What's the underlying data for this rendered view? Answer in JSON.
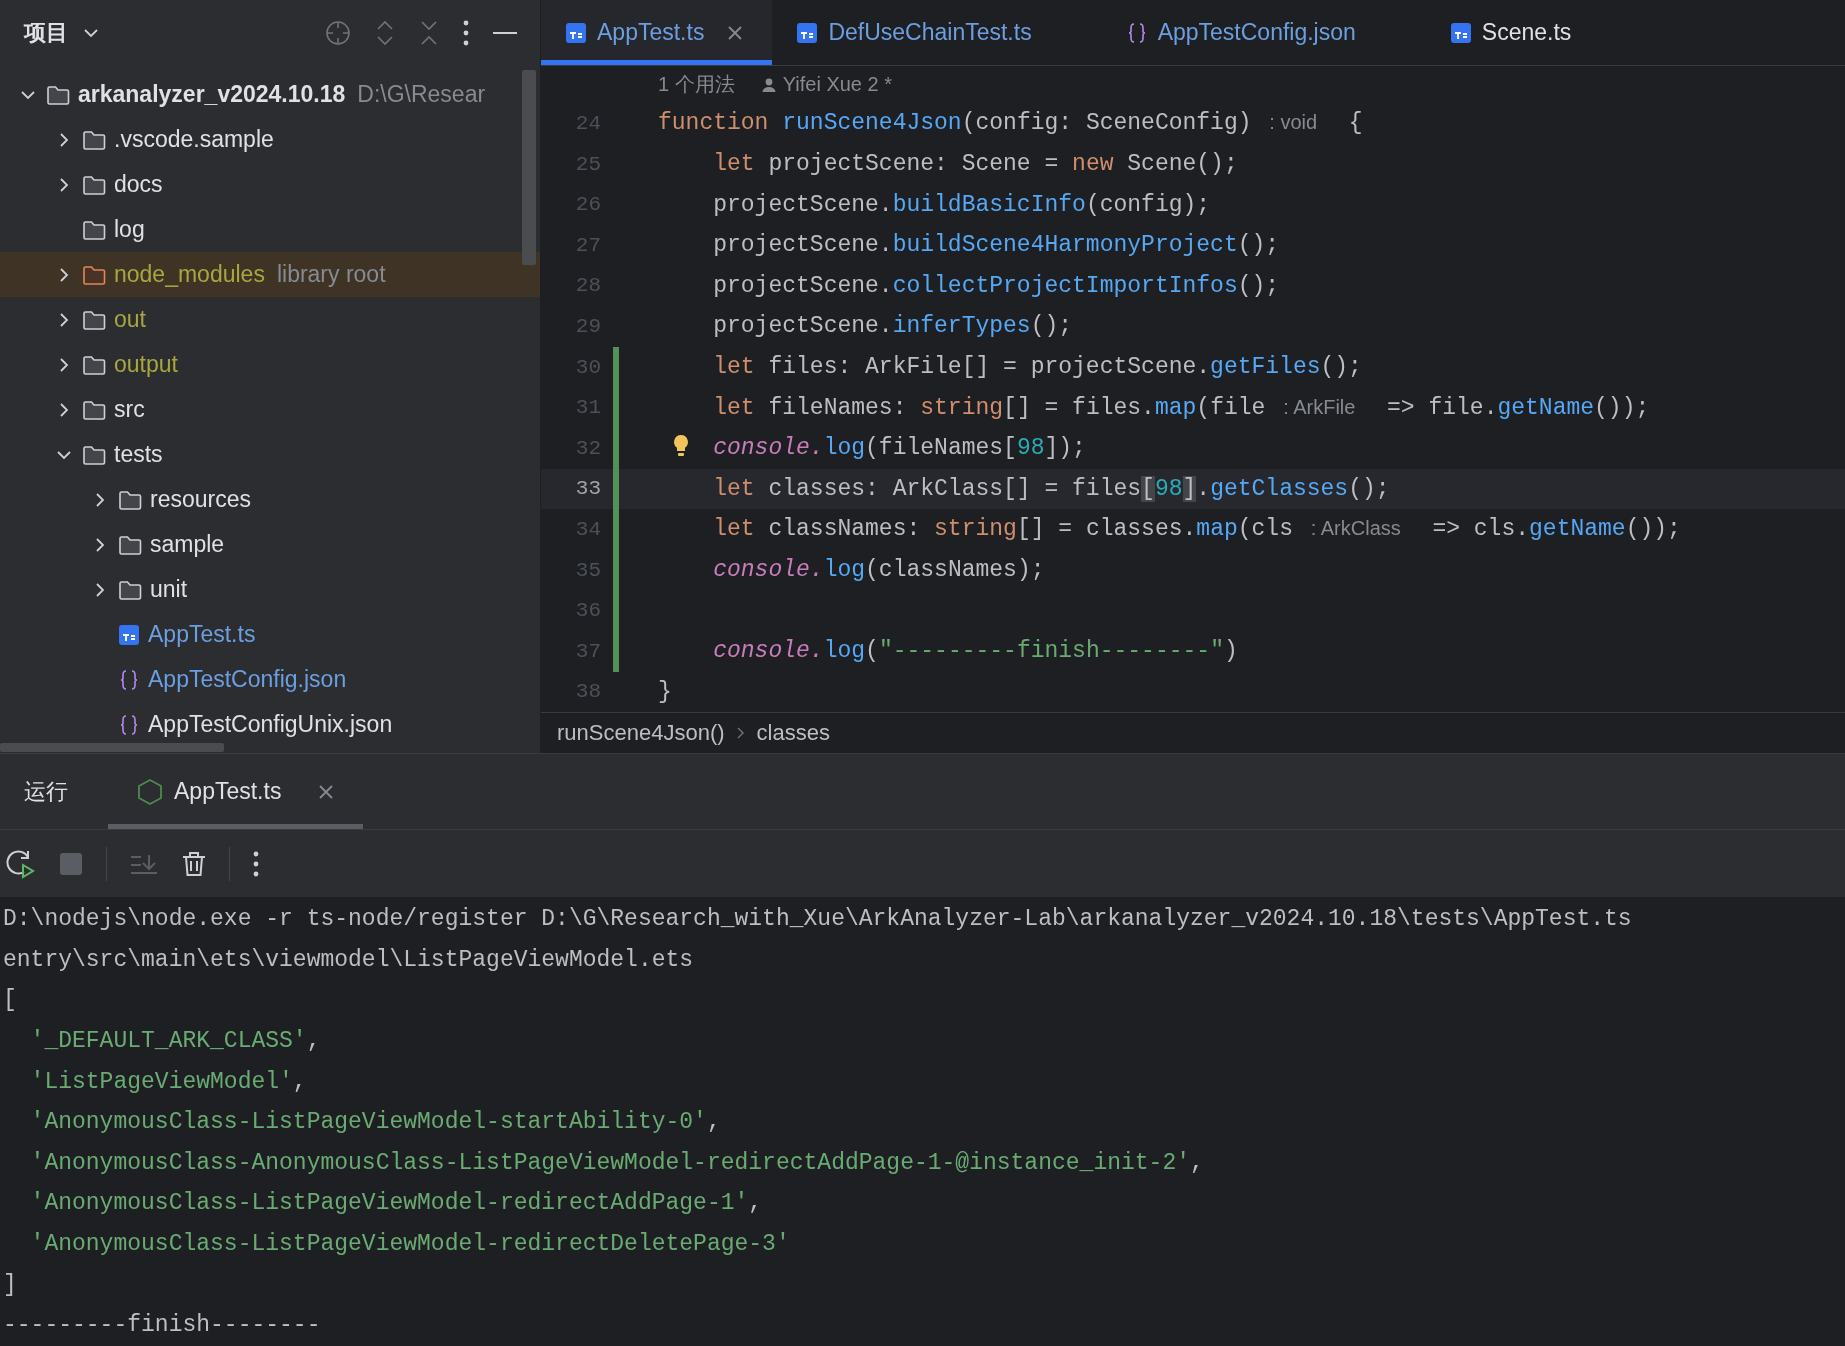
{
  "project_panel": {
    "title": "项目",
    "tree": [
      {
        "label": "arkanalyzer_v2024.10.18",
        "hint": "D:\\G\\Resear",
        "kind": "folder",
        "excluded": false,
        "modified": false,
        "library": false,
        "expanded": true,
        "selected": false,
        "children": [
          {
            "label": ".vscode.sample",
            "kind": "folder",
            "excluded": false,
            "modified": false,
            "library": false,
            "expanded": false,
            "selected": false
          },
          {
            "label": "docs",
            "kind": "folder",
            "excluded": false,
            "modified": false,
            "library": false,
            "expanded": false,
            "selected": false
          },
          {
            "label": "log",
            "kind": "folder",
            "excluded": false,
            "modified": false,
            "library": false,
            "selected": false
          },
          {
            "label": "node_modules",
            "hint": "library root",
            "kind": "folder",
            "excluded": true,
            "modified": false,
            "library": true,
            "expanded": false,
            "selected": true
          },
          {
            "label": "out",
            "kind": "folder",
            "excluded": true,
            "modified": false,
            "library": false,
            "expanded": false,
            "selected": false
          },
          {
            "label": "output",
            "kind": "folder",
            "excluded": true,
            "modified": false,
            "library": false,
            "expanded": false,
            "selected": false
          },
          {
            "label": "src",
            "kind": "folder",
            "excluded": false,
            "modified": false,
            "library": false,
            "expanded": false,
            "selected": false
          },
          {
            "label": "tests",
            "kind": "folder",
            "excluded": false,
            "modified": false,
            "library": false,
            "expanded": true,
            "selected": false,
            "children": [
              {
                "label": "resources",
                "kind": "folder",
                "excluded": false,
                "modified": false,
                "library": false,
                "expanded": false,
                "selected": false
              },
              {
                "label": "sample",
                "kind": "folder",
                "excluded": false,
                "modified": false,
                "library": false,
                "expanded": false,
                "selected": false
              },
              {
                "label": "unit",
                "kind": "folder",
                "excluded": false,
                "modified": false,
                "library": false,
                "expanded": false,
                "selected": false
              },
              {
                "label": "AppTest.ts",
                "kind": "ts",
                "excluded": false,
                "modified": true,
                "library": false,
                "selected": false
              },
              {
                "label": "AppTestConfig.json",
                "kind": "json",
                "excluded": false,
                "modified": true,
                "library": false,
                "selected": false
              },
              {
                "label": "AppTestConfigUnix.json",
                "kind": "json",
                "excluded": false,
                "modified": false,
                "library": false,
                "selected": false
              }
            ]
          }
        ]
      }
    ]
  },
  "editor": {
    "tabs": [
      {
        "label": "AppTest.ts",
        "kind": "ts",
        "modified": true,
        "closable": true,
        "selected": true
      },
      {
        "label": "DefUseChainTest.ts",
        "kind": "ts",
        "modified": true,
        "closable": false,
        "selected": false
      },
      {
        "label": "AppTestConfig.json",
        "kind": "json",
        "modified": true,
        "closable": false,
        "selected": false
      },
      {
        "label": "Scene.ts",
        "kind": "ts",
        "modified": false,
        "closable": false,
        "selected": false
      }
    ],
    "usages": "1 个用法",
    "author": "Yifei Xue 2 *",
    "lines": [
      {
        "number": "24",
        "changed": false,
        "current": false,
        "bulb": false,
        "tokens": [
          {
            "kind": "kw",
            "t": "function "
          },
          {
            "kind": "fn",
            "t": "runScene4Json"
          },
          {
            "kind": "plain",
            "t": "(config: SceneConfig) "
          },
          {
            "kind": "hint",
            "t": ": void"
          },
          {
            "kind": "plain",
            "t": "  {"
          }
        ]
      },
      {
        "number": "25",
        "changed": false,
        "current": false,
        "bulb": false,
        "tokens": [
          {
            "kind": "kw",
            "t": "    let "
          },
          {
            "kind": "plain",
            "t": "projectScene: Scene = "
          },
          {
            "kind": "kw",
            "t": "new "
          },
          {
            "kind": "plain",
            "t": "Scene();"
          }
        ]
      },
      {
        "number": "26",
        "changed": false,
        "current": false,
        "bulb": false,
        "tokens": [
          {
            "kind": "plain",
            "t": "    projectScene."
          },
          {
            "kind": "fn",
            "t": "buildBasicInfo"
          },
          {
            "kind": "plain",
            "t": "(config);"
          }
        ]
      },
      {
        "number": "27",
        "changed": false,
        "current": false,
        "bulb": false,
        "tokens": [
          {
            "kind": "plain",
            "t": "    projectScene."
          },
          {
            "kind": "fn",
            "t": "buildScene4HarmonyProject"
          },
          {
            "kind": "plain",
            "t": "();"
          }
        ]
      },
      {
        "number": "28",
        "changed": false,
        "current": false,
        "bulb": false,
        "tokens": [
          {
            "kind": "plain",
            "t": "    projectScene."
          },
          {
            "kind": "fn",
            "t": "collectProjectImportInfos"
          },
          {
            "kind": "plain",
            "t": "();"
          }
        ]
      },
      {
        "number": "29",
        "changed": false,
        "current": false,
        "bulb": false,
        "tokens": [
          {
            "kind": "plain",
            "t": "    projectScene."
          },
          {
            "kind": "fn",
            "t": "inferTypes"
          },
          {
            "kind": "plain",
            "t": "();"
          }
        ]
      },
      {
        "number": "30",
        "changed": true,
        "current": false,
        "bulb": false,
        "tokens": [
          {
            "kind": "kw",
            "t": "    let "
          },
          {
            "kind": "plain",
            "t": "files: ArkFile[] = projectScene."
          },
          {
            "kind": "fn",
            "t": "getFiles"
          },
          {
            "kind": "plain",
            "t": "();"
          }
        ]
      },
      {
        "number": "31",
        "changed": true,
        "current": false,
        "bulb": false,
        "tokens": [
          {
            "kind": "kw",
            "t": "    let "
          },
          {
            "kind": "plain",
            "t": "fileNames: "
          },
          {
            "kind": "kw",
            "t": "string"
          },
          {
            "kind": "plain",
            "t": "[] = files."
          },
          {
            "kind": "fn",
            "t": "map"
          },
          {
            "kind": "plain",
            "t": "(file "
          },
          {
            "kind": "hint",
            "t": ": ArkFile"
          },
          {
            "kind": "plain",
            "t": "  => file."
          },
          {
            "kind": "fn",
            "t": "getName"
          },
          {
            "kind": "plain",
            "t": "());"
          }
        ]
      },
      {
        "number": "32",
        "changed": true,
        "current": false,
        "bulb": true,
        "tokens": [
          {
            "kind": "console",
            "t": "    console."
          },
          {
            "kind": "fn",
            "t": "log"
          },
          {
            "kind": "plain",
            "t": "(fileNames["
          },
          {
            "kind": "num",
            "t": "98"
          },
          {
            "kind": "plain",
            "t": "]);"
          }
        ]
      },
      {
        "number": "33",
        "changed": true,
        "current": true,
        "bulb": false,
        "tokens": [
          {
            "kind": "kw",
            "t": "    let "
          },
          {
            "kind": "plain",
            "t": "classes: ArkClass[] = files"
          },
          {
            "kind": "match",
            "t": "["
          },
          {
            "kind": "num",
            "t": "98"
          },
          {
            "kind": "match",
            "t": "]"
          },
          {
            "kind": "plain",
            "t": "."
          },
          {
            "kind": "fn",
            "t": "getClasses"
          },
          {
            "kind": "plain",
            "t": "();"
          }
        ]
      },
      {
        "number": "34",
        "changed": true,
        "current": false,
        "bulb": false,
        "tokens": [
          {
            "kind": "kw",
            "t": "    let "
          },
          {
            "kind": "plain",
            "t": "classNames: "
          },
          {
            "kind": "kw",
            "t": "string"
          },
          {
            "kind": "plain",
            "t": "[] = classes."
          },
          {
            "kind": "fn",
            "t": "map"
          },
          {
            "kind": "plain",
            "t": "(cls "
          },
          {
            "kind": "hint",
            "t": ": ArkClass"
          },
          {
            "kind": "plain",
            "t": "  => cls."
          },
          {
            "kind": "fn",
            "t": "getName"
          },
          {
            "kind": "plain",
            "t": "());"
          }
        ]
      },
      {
        "number": "35",
        "changed": true,
        "current": false,
        "bulb": false,
        "tokens": [
          {
            "kind": "console",
            "t": "    console."
          },
          {
            "kind": "fn",
            "t": "log"
          },
          {
            "kind": "plain",
            "t": "(classNames);"
          }
        ]
      },
      {
        "number": "36",
        "changed": true,
        "current": false,
        "bulb": false
      },
      {
        "number": "37",
        "changed": true,
        "current": false,
        "bulb": false,
        "tokens": [
          {
            "kind": "console",
            "t": "    console."
          },
          {
            "kind": "fn",
            "t": "log"
          },
          {
            "kind": "plain",
            "t": "("
          },
          {
            "kind": "str",
            "t": "\"---------finish--------\""
          },
          {
            "kind": "plain",
            "t": ")"
          }
        ]
      },
      {
        "number": "38",
        "changed": false,
        "current": false,
        "bulb": false,
        "tokens": [
          {
            "kind": "plain",
            "t": "}"
          }
        ]
      }
    ],
    "breadcrumbs": [
      "runScene4Json()",
      "classes"
    ]
  },
  "run_panel": {
    "title": "运行",
    "tabs": [
      {
        "label": "AppTest.ts",
        "selected": true
      }
    ],
    "toolbar": [
      {
        "kind": "rerun",
        "disabled": false
      },
      {
        "kind": "stop",
        "disabled": true
      },
      {
        "kind": "separator"
      },
      {
        "kind": "scroll-end",
        "disabled": true
      },
      {
        "kind": "clear",
        "disabled": false
      },
      {
        "kind": "separator"
      },
      {
        "kind": "more",
        "disabled": false
      }
    ],
    "console": [
      {
        "tokens": [
          {
            "kind": "plain",
            "t": "D:\\nodejs\\node.exe -r ts-node/register D:\\G\\Research_with_Xue\\ArkAnalyzer-Lab\\arkanalyzer_v2024.10.18\\tests\\AppTest.ts"
          }
        ]
      },
      {
        "tokens": [
          {
            "kind": "plain",
            "t": "entry\\src\\main\\ets\\viewmodel\\ListPageViewModel.ets"
          }
        ]
      },
      {
        "tokens": [
          {
            "kind": "plain",
            "t": "["
          }
        ]
      },
      {
        "tokens": [
          {
            "kind": "str",
            "t": "  '_DEFAULT_ARK_CLASS'"
          },
          {
            "kind": "plain",
            "t": ","
          }
        ]
      },
      {
        "tokens": [
          {
            "kind": "str",
            "t": "  'ListPageViewModel'"
          },
          {
            "kind": "plain",
            "t": ","
          }
        ]
      },
      {
        "tokens": [
          {
            "kind": "str",
            "t": "  'AnonymousClass-ListPageViewModel-startAbility-0'"
          },
          {
            "kind": "plain",
            "t": ","
          }
        ]
      },
      {
        "tokens": [
          {
            "kind": "str",
            "t": "  'AnonymousClass-AnonymousClass-ListPageViewModel-redirectAddPage-1-@instance_init-2'"
          },
          {
            "kind": "plain",
            "t": ","
          }
        ]
      },
      {
        "tokens": [
          {
            "kind": "str",
            "t": "  'AnonymousClass-ListPageViewModel-redirectAddPage-1'"
          },
          {
            "kind": "plain",
            "t": ","
          }
        ]
      },
      {
        "tokens": [
          {
            "kind": "str",
            "t": "  'AnonymousClass-ListPageViewModel-redirectDeletePage-3'"
          }
        ]
      },
      {
        "tokens": [
          {
            "kind": "plain",
            "t": "]"
          }
        ]
      },
      {
        "tokens": [
          {
            "kind": "plain",
            "t": "---------finish--------"
          }
        ]
      }
    ]
  }
}
